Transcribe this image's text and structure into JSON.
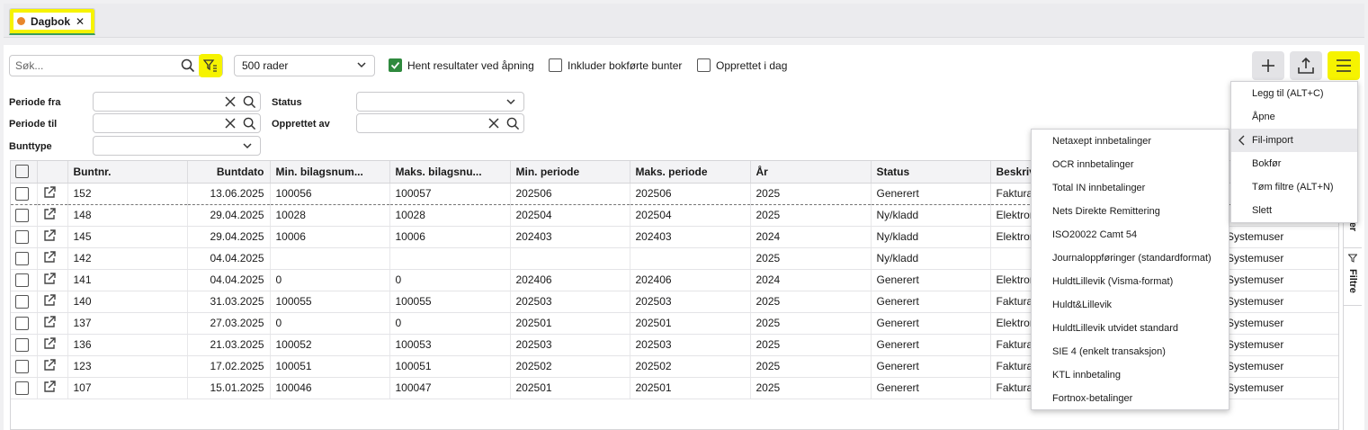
{
  "tab": {
    "label": "Dagbok",
    "close": "✕"
  },
  "toolbar": {
    "search_placeholder": "Søk...",
    "rows_select": "500 rader",
    "checkbox_fetch": "Hent resultater ved åpning",
    "checkbox_include": "Inkluder bokførte bunter",
    "checkbox_created": "Opprettet i dag"
  },
  "filters": {
    "periode_fra": "Periode fra",
    "periode_til": "Periode til",
    "bunttype": "Bunttype",
    "status": "Status",
    "opprettet_av": "Opprettet av"
  },
  "table": {
    "headers": [
      "Buntnr.",
      "Buntdato",
      "Min. bilagsnum...",
      "Maks. bilagsnu...",
      "Min. periode",
      "Maks. periode",
      "År",
      "Status",
      "Beskrive"
    ],
    "rows": [
      [
        "152",
        "13.06.2025",
        "100056",
        "100057",
        "202506",
        "202506",
        "2025",
        "Generert",
        "Fakturajo"
      ],
      [
        "148",
        "29.04.2025",
        "10028",
        "10028",
        "202504",
        "202504",
        "2025",
        "Ny/kladd",
        "Elektronis"
      ],
      [
        "145",
        "29.04.2025",
        "10006",
        "10006",
        "202403",
        "202403",
        "2024",
        "Ny/kladd",
        "Elektronis"
      ],
      [
        "142",
        "04.04.2025",
        "",
        "",
        "",
        "",
        "2025",
        "Ny/kladd",
        ""
      ],
      [
        "141",
        "04.04.2025",
        "0",
        "0",
        "202406",
        "202406",
        "2024",
        "Generert",
        "Elektronis"
      ],
      [
        "140",
        "31.03.2025",
        "100055",
        "100055",
        "202503",
        "202503",
        "2025",
        "Generert",
        "Fakturajo"
      ],
      [
        "137",
        "27.03.2025",
        "0",
        "0",
        "202501",
        "202501",
        "2025",
        "Generert",
        "Elektronis"
      ],
      [
        "136",
        "21.03.2025",
        "100052",
        "100053",
        "202503",
        "202503",
        "2025",
        "Generert",
        "Fakturajo"
      ],
      [
        "123",
        "17.02.2025",
        "100051",
        "100051",
        "202502",
        "202502",
        "2025",
        "Generert",
        "Fakturajo"
      ],
      [
        "107",
        "15.01.2025",
        "100046",
        "100047",
        "202501",
        "202501",
        "2025",
        "Generert",
        "Fakturajo"
      ]
    ],
    "overflow_values": [
      "Systemuser",
      "Systemuser",
      "Systemuser",
      "Systemuser",
      "Systemuser",
      "Systemuser",
      "Systemuser",
      "Systemuser"
    ]
  },
  "side_tabs": {
    "partial": "ner",
    "filters": "Filtre"
  },
  "action_menu": {
    "items": [
      "Legg til (ALT+C)",
      "Åpne",
      "Fil-import",
      "Bokfør",
      "Tøm filtre (ALT+N)",
      "Slett"
    ],
    "active_index": 2
  },
  "import_menu": {
    "items": [
      "Netaxept innbetalinger",
      "OCR innbetalinger",
      "Total IN innbetalinger",
      "Nets Direkte Remittering",
      "ISO20022 Camt 54",
      "Journaloppføringer (standardformat)",
      "HuldtLillevik (Visma-format)",
      "Huldt&Lillevik",
      "HuldtLillevik utvidet standard",
      "SIE 4 (enkelt transaksjon)",
      "KTL innbetaling",
      "Fortnox-betalinger"
    ]
  },
  "colors": {
    "highlight": "#f6f300",
    "accent_green": "#2f8a3e",
    "tab_dot": "#e8872b"
  }
}
